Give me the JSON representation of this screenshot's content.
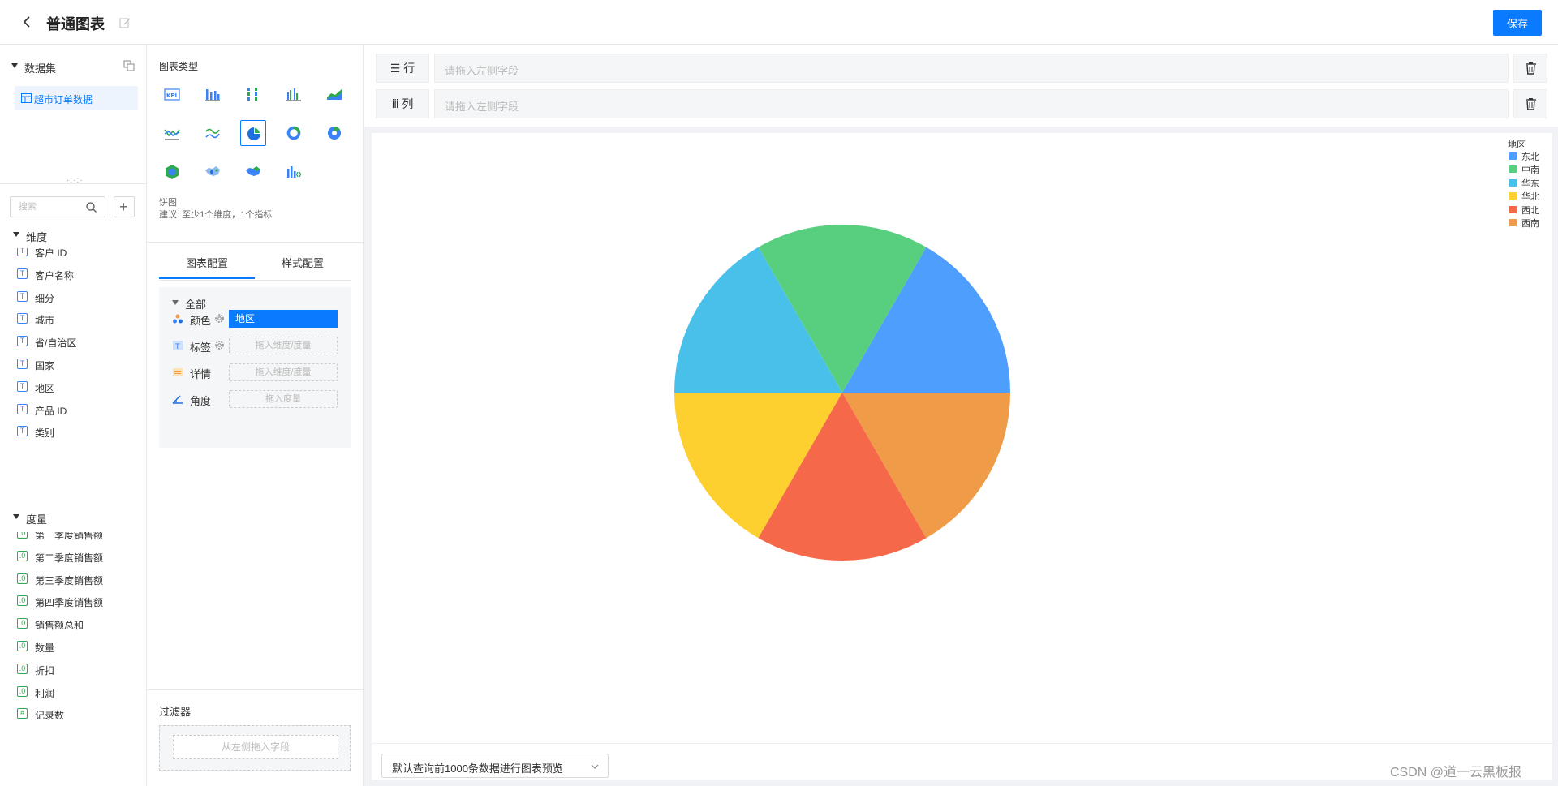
{
  "header": {
    "title": "普通图表",
    "save_label": "保存"
  },
  "left": {
    "dataset_label": "数据集",
    "dataset_item": "超市订单数据",
    "search_placeholder": "搜索",
    "dimension_label": "维度",
    "dimensions": [
      "客户 ID",
      "客户名称",
      "细分",
      "城市",
      "省/自治区",
      "国家",
      "地区",
      "产品 ID",
      "类别"
    ],
    "measure_label": "度量",
    "measures": [
      {
        "badge": ".0",
        "label": "第一季度销售额"
      },
      {
        "badge": ".0",
        "label": "第二季度销售额"
      },
      {
        "badge": ".0",
        "label": "第三季度销售额"
      },
      {
        "badge": ".0",
        "label": "第四季度销售额"
      },
      {
        "badge": ".0",
        "label": "销售额总和"
      },
      {
        "badge": ".0",
        "label": "数量"
      },
      {
        "badge": ".0",
        "label": "折扣"
      },
      {
        "badge": ".0",
        "label": "利润"
      },
      {
        "badge": "#",
        "label": "记录数"
      }
    ]
  },
  "mid": {
    "chart_type_title": "图表类型",
    "chart_type_name": "饼图",
    "chart_type_hint": "建议: 至少1个维度，1个指标",
    "tab_config": "图表配置",
    "tab_style": "样式配置",
    "cfg_all": "全部",
    "cfg_color_label": "颜色",
    "cfg_color_value": "地区",
    "cfg_label_label": "标签",
    "cfg_label_drop": "拖入维度/度量",
    "cfg_detail_label": "详情",
    "cfg_detail_drop": "拖入维度/度量",
    "cfg_angle_label": "角度",
    "cfg_angle_drop": "拖入度量",
    "filter_title": "过滤器",
    "filter_drop": "从左侧拖入字段"
  },
  "right": {
    "row_label": "行",
    "col_label": "列",
    "row_placeholder": "请拖入左侧字段",
    "col_placeholder": "请拖入左侧字段",
    "preview_select": "默认查询前1000条数据进行图表预览"
  },
  "watermark": "CSDN @道一云黑板报",
  "chart_data": {
    "type": "pie",
    "title": "",
    "legend_title": "地区",
    "legend_position": "top-right",
    "categories": [
      "东北",
      "中南",
      "华东",
      "华北",
      "西北",
      "西南"
    ],
    "values": [
      1,
      1,
      1,
      1,
      1,
      1
    ],
    "colors": [
      "#4e9efd",
      "#58cf7f",
      "#48c0ea",
      "#fdcf2f",
      "#f56849",
      "#f09b48"
    ]
  }
}
